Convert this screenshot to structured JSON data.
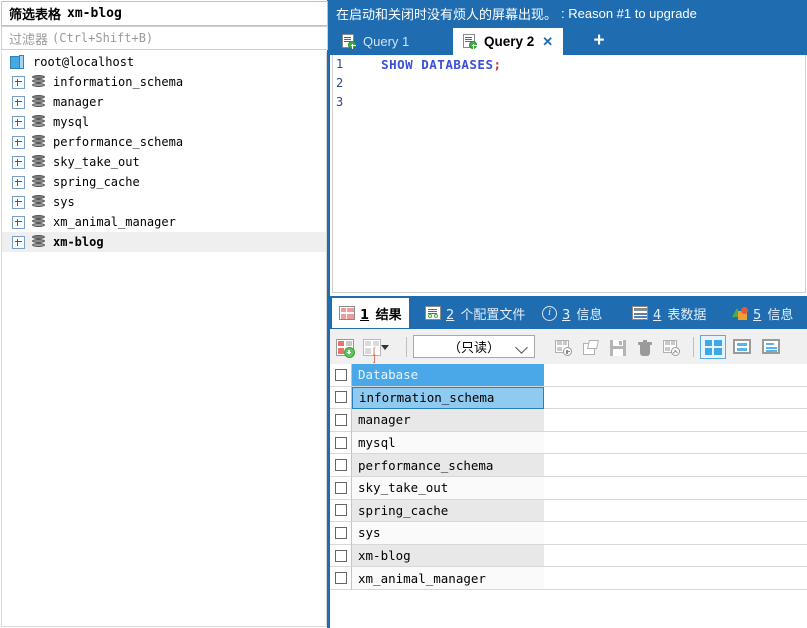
{
  "left_panel": {
    "filter_title_cn": "筛选表格",
    "filter_title_db": "xm-blog",
    "filter_placeholder_cn": "过滤器",
    "filter_placeholder_shortcut": "(Ctrl+Shift+B)",
    "tree": {
      "root_label": "root@localhost",
      "items": [
        {
          "label": "information_schema"
        },
        {
          "label": "manager"
        },
        {
          "label": "mysql"
        },
        {
          "label": "performance_schema"
        },
        {
          "label": "sky_take_out"
        },
        {
          "label": "spring_cache"
        },
        {
          "label": "sys"
        },
        {
          "label": "xm_animal_manager"
        },
        {
          "label": "xm-blog",
          "selected": true
        }
      ]
    }
  },
  "right_panel": {
    "promo_cn": "在启动和关闭时没有烦人的屏幕出现。",
    "promo_en": ": Reason #1 to upgrade",
    "query_tabs": [
      {
        "label": "Query 1",
        "active": false
      },
      {
        "label": "Query 2",
        "active": true,
        "close": "✕"
      }
    ],
    "add_tab_label": "+",
    "editor": {
      "line_numbers": [
        "1",
        "2",
        "3"
      ],
      "keyword": "SHOW DATABASES",
      "terminator": ";"
    },
    "result_tabs": [
      {
        "num": "1",
        "label": "结果",
        "active": true
      },
      {
        "num": "2",
        "label": "个配置文件",
        "active": false
      },
      {
        "num": "3",
        "label": "信息",
        "active": false
      },
      {
        "num": "4",
        "label": "表数据",
        "active": false
      },
      {
        "num": "5",
        "label": "信息",
        "active": false
      }
    ],
    "grid_toolbar": {
      "mode_value": "（只读）"
    },
    "result_grid": {
      "column_header": "Database",
      "rows": [
        {
          "value": "information_schema",
          "selected": true
        },
        {
          "value": "manager"
        },
        {
          "value": "mysql"
        },
        {
          "value": "performance_schema"
        },
        {
          "value": "sky_take_out"
        },
        {
          "value": "spring_cache"
        },
        {
          "value": "sys"
        },
        {
          "value": "xm-blog"
        },
        {
          "value": "xm_animal_manager"
        }
      ]
    }
  },
  "colors": {
    "accent_blue": "#1f6cb0",
    "header_blue": "#4aa8e8",
    "selection_blue": "#8fcbf0",
    "keyword_blue": "#3b4fd8",
    "punctuation_red": "#c0392b"
  }
}
